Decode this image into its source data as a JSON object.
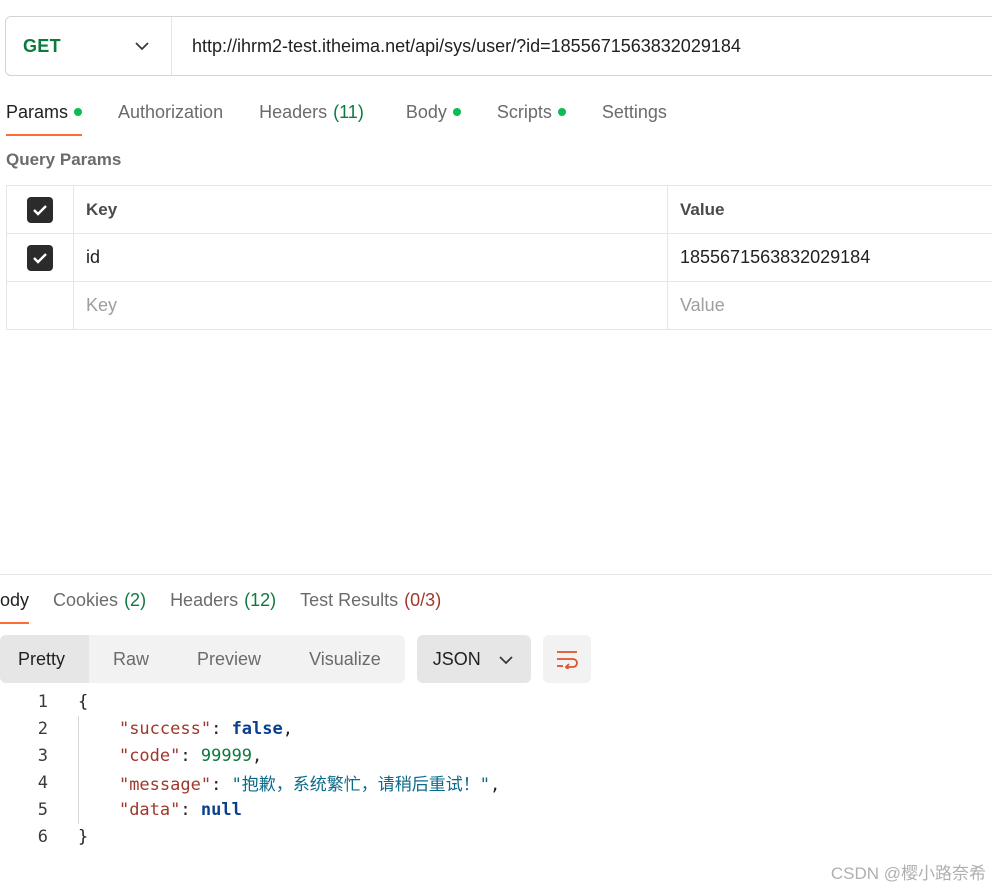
{
  "request": {
    "method": "GET",
    "url": "http://ihrm2-test.itheima.net/api/sys/user/?id=1855671563832029184"
  },
  "request_tabs": [
    {
      "label": "Params",
      "dot": true,
      "active": true
    },
    {
      "label": "Authorization"
    },
    {
      "label": "Headers",
      "count": "(11)"
    },
    {
      "label": "Body",
      "dot": true
    },
    {
      "label": "Scripts",
      "dot": true
    },
    {
      "label": "Settings"
    }
  ],
  "query_params": {
    "title": "Query Params",
    "header": {
      "key": "Key",
      "value": "Value"
    },
    "rows": [
      {
        "checked": true,
        "key": "id",
        "value": "1855671563832029184"
      }
    ],
    "placeholder": {
      "key": "Key",
      "value": "Value"
    }
  },
  "response_tabs": [
    {
      "label": "Body",
      "active": true
    },
    {
      "label": "Cookies",
      "count": "(2)"
    },
    {
      "label": "Headers",
      "count": "(12)"
    },
    {
      "label": "Test Results",
      "count": "(0/3)",
      "count_color": "red"
    }
  ],
  "view_modes": [
    "Pretty",
    "Raw",
    "Preview",
    "Visualize"
  ],
  "active_view": "Pretty",
  "format": "JSON",
  "response_body": {
    "line_numbers": [
      "1",
      "2",
      "3",
      "4",
      "5",
      "6"
    ],
    "open_brace": "{",
    "close_brace": "}",
    "success_key": "\"success\"",
    "success_value": "false",
    "code_key": "\"code\"",
    "code_value": "99999",
    "message_key": "\"message\"",
    "message_value": "\"抱歉，系统繁忙，请稍后重试！\"",
    "data_key": "\"data\"",
    "data_value": "null"
  },
  "watermark": "CSDN @樱小路奈希",
  "colors": {
    "method_get": "#0b7a3e",
    "active_tab_underline": "#ff6c37",
    "status_dot": "#0cbb52"
  }
}
